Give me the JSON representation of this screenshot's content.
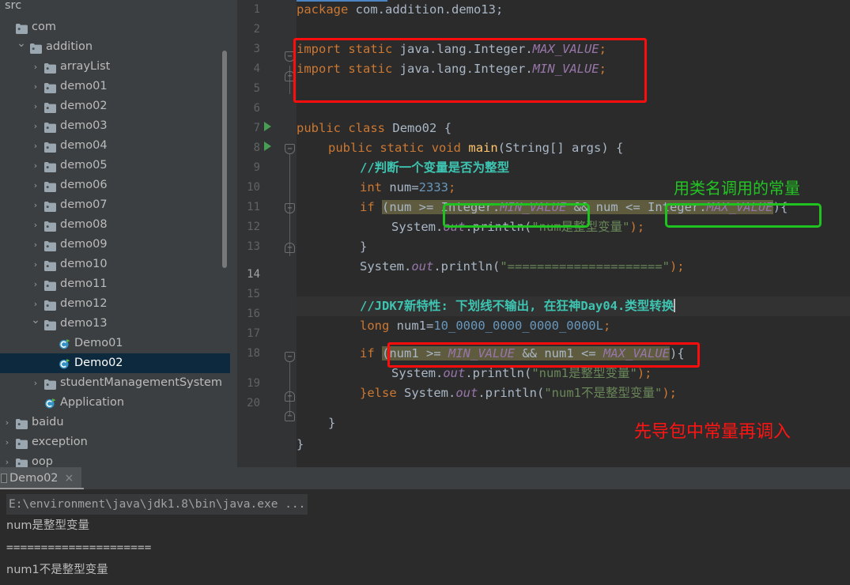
{
  "sidebar": {
    "root_label": "src",
    "scrollbar": "vertical-scrollbar",
    "items": [
      {
        "label": "com",
        "indent": 0,
        "twisty": "",
        "icon": "folder-icon",
        "selected": false
      },
      {
        "label": "addition",
        "indent": 1,
        "twisty": "v",
        "icon": "folder-icon",
        "selected": false
      },
      {
        "label": "arrayList",
        "indent": 2,
        "twisty": ">",
        "icon": "folder-icon",
        "selected": false
      },
      {
        "label": "demo01",
        "indent": 2,
        "twisty": ">",
        "icon": "folder-icon",
        "selected": false
      },
      {
        "label": "demo02",
        "indent": 2,
        "twisty": ">",
        "icon": "folder-icon",
        "selected": false
      },
      {
        "label": "demo03",
        "indent": 2,
        "twisty": ">",
        "icon": "folder-icon",
        "selected": false
      },
      {
        "label": "demo04",
        "indent": 2,
        "twisty": ">",
        "icon": "folder-icon",
        "selected": false
      },
      {
        "label": "demo05",
        "indent": 2,
        "twisty": ">",
        "icon": "folder-icon",
        "selected": false
      },
      {
        "label": "demo06",
        "indent": 2,
        "twisty": ">",
        "icon": "folder-icon",
        "selected": false
      },
      {
        "label": "demo07",
        "indent": 2,
        "twisty": ">",
        "icon": "folder-icon",
        "selected": false
      },
      {
        "label": "demo08",
        "indent": 2,
        "twisty": ">",
        "icon": "folder-icon",
        "selected": false
      },
      {
        "label": "demo09",
        "indent": 2,
        "twisty": ">",
        "icon": "folder-icon",
        "selected": false
      },
      {
        "label": "demo10",
        "indent": 2,
        "twisty": ">",
        "icon": "folder-icon",
        "selected": false
      },
      {
        "label": "demo11",
        "indent": 2,
        "twisty": ">",
        "icon": "folder-icon",
        "selected": false
      },
      {
        "label": "demo12",
        "indent": 2,
        "twisty": ">",
        "icon": "folder-icon",
        "selected": false
      },
      {
        "label": "demo13",
        "indent": 2,
        "twisty": "v",
        "icon": "folder-icon",
        "selected": false
      },
      {
        "label": "Demo01",
        "indent": 3,
        "twisty": "",
        "icon": "java-class-icon",
        "selected": false
      },
      {
        "label": "Demo02",
        "indent": 3,
        "twisty": "",
        "icon": "java-class-icon",
        "selected": true
      },
      {
        "label": "studentManagementSystem",
        "indent": 2,
        "twisty": ">",
        "icon": "folder-icon",
        "selected": false
      },
      {
        "label": "Application",
        "indent": 2,
        "twisty": "",
        "icon": "java-class-icon",
        "selected": false
      },
      {
        "label": "baidu",
        "indent": 0,
        "twisty": ">",
        "icon": "folder-icon",
        "selected": false
      },
      {
        "label": "exception",
        "indent": 0,
        "twisty": ">",
        "icon": "folder-icon",
        "selected": false
      },
      {
        "label": "oop",
        "indent": 0,
        "twisty": ">",
        "icon": "folder-icon",
        "selected": false
      }
    ]
  },
  "editor": {
    "line_numbers": [
      "1",
      "2",
      "3",
      "4",
      "5",
      "6",
      "7",
      "8",
      "9",
      "10",
      "11",
      "12",
      "13",
      "14",
      "15",
      "16",
      "17",
      "18",
      "19",
      "20"
    ],
    "current_line": "14",
    "run_gutter_lines": [
      "6",
      "7"
    ],
    "code_lines": [
      {
        "n": 1,
        "text": "package com.addition.demo13;"
      },
      {
        "n": 2,
        "text": ""
      },
      {
        "n": 3,
        "text": "import static java.lang.Integer.MAX_VALUE;"
      },
      {
        "n": 4,
        "text": "import static java.lang.Integer.MIN_VALUE;"
      },
      {
        "n": 5,
        "text": ""
      },
      {
        "n": 6,
        "text": "public class Demo02 {"
      },
      {
        "n": 7,
        "text": "    public static void main(String[] args) {"
      },
      {
        "n": 8,
        "text": "        //判断一个变量是否为整型"
      },
      {
        "n": 9,
        "text": "        int num=2333;"
      },
      {
        "n": 10,
        "text": "        if (num >= Integer.MIN_VALUE && num <= Integer.MAX_VALUE){"
      },
      {
        "n": 11,
        "text": "            System.out.println(\"num是整型变量\");"
      },
      {
        "n": 12,
        "text": "        }"
      },
      {
        "n": 13,
        "text": "        System.out.println(\"=====================\");"
      },
      {
        "n": 14,
        "text": "        //JDK7新特性: 下划线不输出, 在狂神Day04.类型转换"
      },
      {
        "n": 15,
        "text": "        long num1=10_0000_0000_0000_0000L;"
      },
      {
        "n": 16,
        "text": "        if (num1 >= MIN_VALUE && num1 <= MAX_VALUE){"
      },
      {
        "n": 17,
        "text": "            System.out.println(\"num1是整型变量\");"
      },
      {
        "n": 18,
        "text": "        }else System.out.println(\"num1不是整型变量\");"
      },
      {
        "n": 19,
        "text": "    }"
      },
      {
        "n": 20,
        "text": "}"
      }
    ],
    "tokens": {
      "kw_package": "package",
      "pkg_name": "com.addition.demo13;",
      "kw_import": "import",
      "kw_static": "static",
      "import_path_max": " java.lang.Integer.",
      "const_max": "MAX_VALUE",
      "const_min": "MIN_VALUE",
      "semicolon": ";",
      "kw_public": "public",
      "kw_class": "class",
      "class_name": "Demo02",
      "brace_open": " {",
      "kw_void": "void",
      "method_main": "main",
      "main_params": "(String[] args) {",
      "comment_cn_1": "//判断一个变量是否为整型",
      "kw_int": "int",
      "num_decl": " num=",
      "num_value": "2333",
      "kw_if": "if",
      "cond1_a": "(num >= ",
      "cond1_integer": "Integer.",
      "cond1_mid": " && num <= ",
      "cond1_tail": "){",
      "sys_out_1": "System.",
      "out_field": "out",
      "println": ".println(",
      "str_num_int": "\"num是整型变量\"",
      "close_paren_semi": ");",
      "brace_close": "}",
      "str_equals": "\"=====================\"",
      "comment_cn_2": "//JDK7新特性: 下划线不输出, 在狂神Day04.类型转换",
      "kw_long": "long",
      "num1_decl": " num1=",
      "num1_value": "10_0000_0000_0000_0000L",
      "cond2_a": "(num1 >= ",
      "cond2_mid": " && num1 <= ",
      "cond2_tail": "){",
      "str_num1_int": "\"num1是整型变量\"",
      "kw_else": "}else ",
      "str_num1_notint": "\"num1不是整型变量\""
    },
    "annotations": [
      {
        "name": "annotation-green-classname",
        "text": "用类名调用的常量",
        "color": "#22C522"
      },
      {
        "name": "annotation-red-import",
        "text": "先导包中常量再调入",
        "color": "#FF1414"
      }
    ],
    "highlight_colors": {
      "red_box": "#FF0D0D",
      "green_box": "#1FC21F",
      "selection": "#5E5B3F",
      "current_line": "#323232"
    }
  },
  "console": {
    "tab_label": "Demo02",
    "tab_close": "×",
    "lines": [
      {
        "text": "E:\\environment\\java\\jdk1.8\\bin\\java.exe ...",
        "style": "cmd"
      },
      {
        "text": "num是整型变量",
        "style": "out"
      },
      {
        "text": "=====================",
        "style": "mono"
      },
      {
        "text": "num1不是整型变量",
        "style": "out"
      }
    ]
  }
}
